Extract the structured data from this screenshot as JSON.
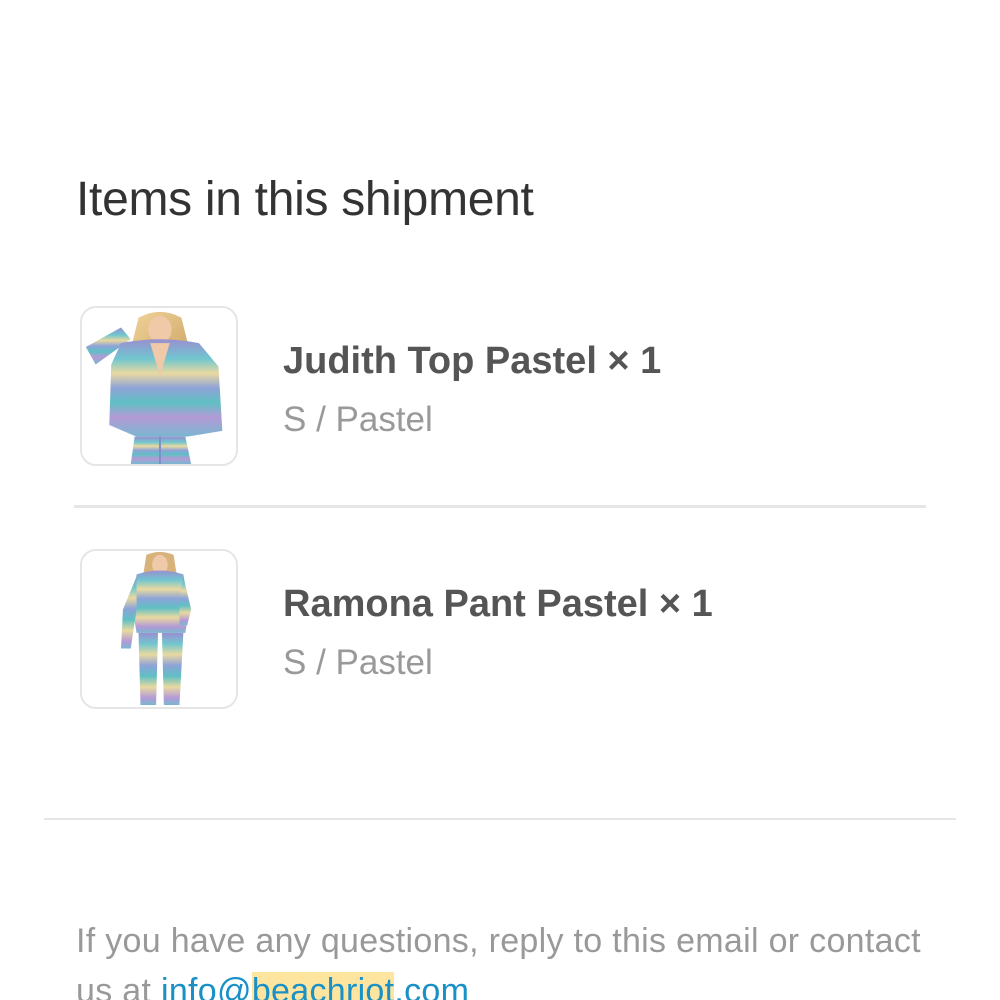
{
  "shipment": {
    "heading": "Items in this shipment",
    "items": [
      {
        "title": "Judith Top Pastel × 1",
        "variant": "S / Pastel",
        "image_icon": "product-photo-cardigan-top"
      },
      {
        "title": "Ramona Pant Pastel × 1",
        "variant": "S / Pastel",
        "image_icon": "product-photo-knit-set"
      }
    ]
  },
  "footer": {
    "text_before": "If you have any questions, reply to this email or contact us at ",
    "link_prefix": "info@",
    "link_highlight": "beachriot",
    "link_suffix": ".com"
  },
  "colors": {
    "text": "#333333",
    "muted": "#999999",
    "link": "#1990c6",
    "highlight": "#fde5a0",
    "divider": "#e6e6e6"
  }
}
